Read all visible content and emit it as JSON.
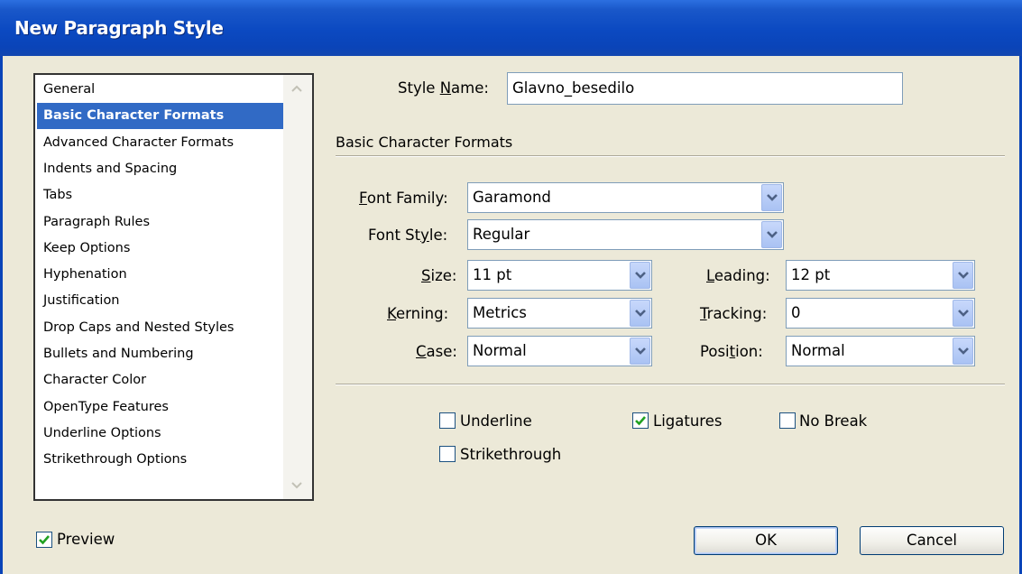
{
  "window": {
    "title": "New Paragraph Style"
  },
  "categories": [
    {
      "label": "General"
    },
    {
      "label": "Basic Character Formats",
      "selected": true
    },
    {
      "label": "Advanced Character Formats"
    },
    {
      "label": "Indents and Spacing"
    },
    {
      "label": "Tabs"
    },
    {
      "label": "Paragraph Rules"
    },
    {
      "label": "Keep Options"
    },
    {
      "label": "Hyphenation"
    },
    {
      "label": "Justification"
    },
    {
      "label": "Drop Caps and Nested Styles"
    },
    {
      "label": "Bullets and Numbering"
    },
    {
      "label": "Character Color"
    },
    {
      "label": "OpenType Features"
    },
    {
      "label": "Underline Options"
    },
    {
      "label": "Strikethrough Options"
    }
  ],
  "style_name": {
    "label_pre": "Style ",
    "label_u": "N",
    "label_post": "ame:",
    "value": "Glavno_besedilo"
  },
  "section": {
    "heading": "Basic Character Formats"
  },
  "fields": {
    "font_family": {
      "label_u": "F",
      "label_post": "ont Family:",
      "value": "Garamond"
    },
    "font_style": {
      "label_pre": "Font St",
      "label_u": "y",
      "label_post": "le:",
      "value": "Regular"
    },
    "size": {
      "label_u": "S",
      "label_post": "ize:",
      "value": "11 pt"
    },
    "leading": {
      "label_u": "L",
      "label_post": "eading:",
      "value": "12 pt"
    },
    "kerning": {
      "label_u": "K",
      "label_post": "erning:",
      "value": "Metrics"
    },
    "tracking": {
      "label_u": "T",
      "label_post": "racking:",
      "value": "0"
    },
    "case": {
      "label_u": "C",
      "label_post": "ase:",
      "value": "Normal"
    },
    "position": {
      "label_pre": "Posi",
      "label_u": "t",
      "label_post": "ion:",
      "value": "Normal"
    }
  },
  "checkboxes": {
    "underline": {
      "label": "Underline",
      "checked": false
    },
    "ligatures": {
      "label": "Ligatures",
      "checked": true
    },
    "no_break": {
      "label": "No Break",
      "checked": false
    },
    "strikethrough": {
      "label": "Strikethrough",
      "checked": false
    },
    "preview": {
      "label": "Preview",
      "checked": true
    }
  },
  "buttons": {
    "ok": "OK",
    "cancel": "Cancel"
  },
  "colors": {
    "titlebar": "#0a44b8",
    "selection": "#316ac5",
    "dialog_bg": "#ece9d8"
  }
}
